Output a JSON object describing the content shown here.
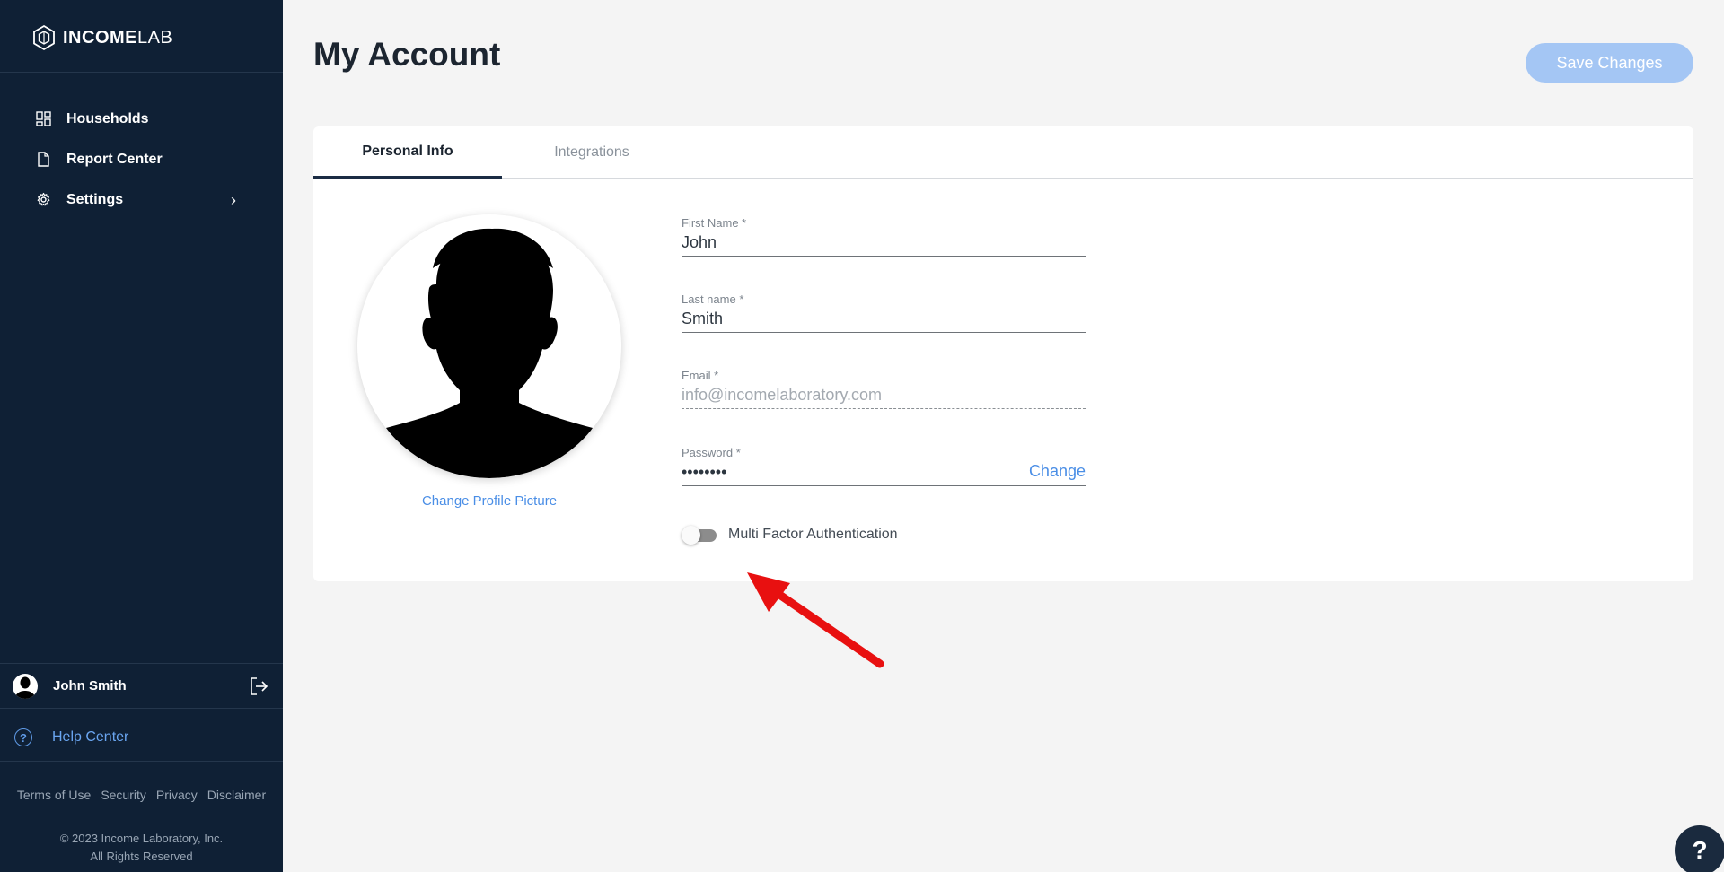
{
  "brand": {
    "bold": "INCOME",
    "light": "LAB",
    "logo_icon": "hexagon-logo-icon"
  },
  "sidebar": {
    "items": [
      {
        "label": "Households",
        "icon": "grid-icon"
      },
      {
        "label": "Report Center",
        "icon": "document-icon"
      },
      {
        "label": "Settings",
        "icon": "gear-icon",
        "chevron": "›"
      }
    ],
    "user": {
      "name": "John Smith"
    },
    "help": {
      "label": "Help Center",
      "icon_glyph": "?"
    },
    "footer_links": [
      "Terms of Use",
      "Security",
      "Privacy",
      "Disclaimer"
    ],
    "copyright_line1": "© 2023 Income Laboratory, Inc.",
    "copyright_line2": "All Rights Reserved"
  },
  "header": {
    "title": "My Account",
    "save_label": "Save Changes"
  },
  "tabs": [
    {
      "label": "Personal Info",
      "active": true
    },
    {
      "label": "Integrations",
      "active": false
    }
  ],
  "profile": {
    "change_picture_label": "Change Profile Picture"
  },
  "form": {
    "first_name": {
      "label": "First Name *",
      "value": "John"
    },
    "last_name": {
      "label": "Last name *",
      "value": "Smith"
    },
    "email": {
      "label": "Email *",
      "value": "info@incomelaboratory.com"
    },
    "password": {
      "label": "Password *",
      "value": "••••••••",
      "change_label": "Change"
    },
    "mfa": {
      "label": "Multi Factor Authentication",
      "enabled": false
    }
  },
  "help_fab": {
    "glyph": "?"
  },
  "colors": {
    "sidebar_bg": "#0f2035",
    "accent": "#4a8ee6",
    "save_button": "#a4c6f4",
    "annotation_arrow": "#e81010"
  }
}
